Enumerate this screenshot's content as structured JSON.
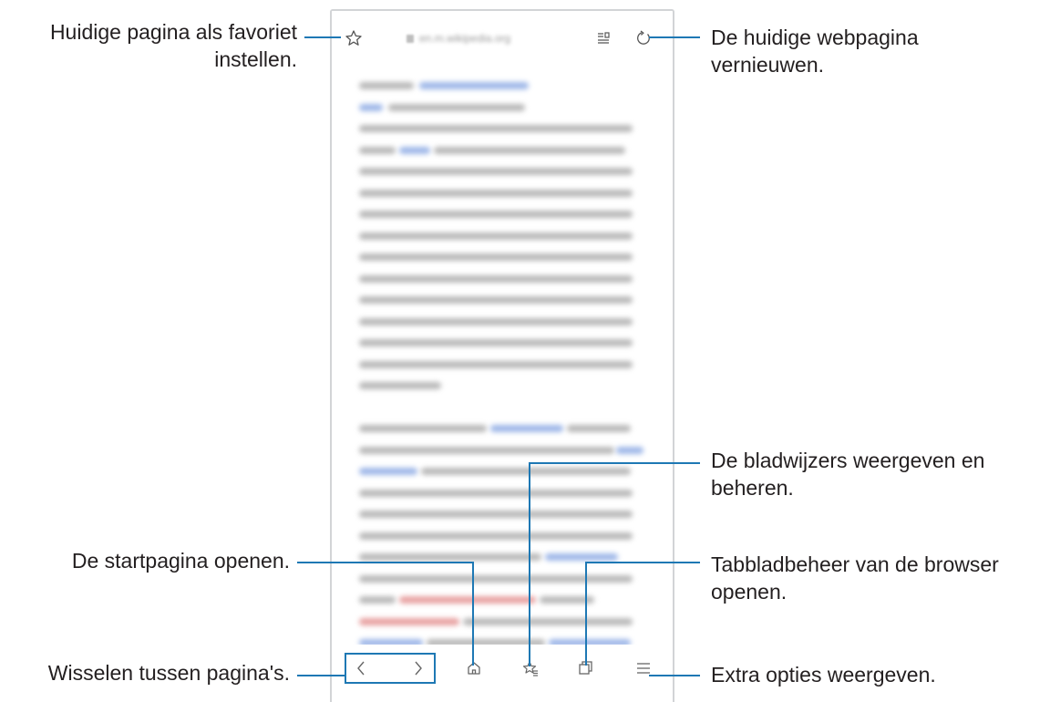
{
  "browser": {
    "url": "en.m.wikipedia.org",
    "icons": {
      "favorite": "star-outline-icon",
      "reader": "reader-mode-icon",
      "refresh": "refresh-icon",
      "back": "chevron-left-icon",
      "forward": "chevron-right-icon",
      "home": "home-icon",
      "bookmarks": "bookmark-star-icon",
      "tabs": "tabs-icon",
      "menu": "hamburger-menu-icon"
    }
  },
  "callouts": {
    "favorite": "Huidige pagina als favoriet instellen.",
    "refresh": "De huidige webpagina vernieuwen.",
    "bookmarks": "De bladwijzers weergeven en beheren.",
    "home": "De startpagina openen.",
    "tabs": "Tabbladbeheer van de browser openen.",
    "navigate": "Wisselen tussen pagina's.",
    "options": "Extra opties weergeven."
  },
  "colors": {
    "leader": "#1e78b4",
    "text": "#231f20",
    "frame": "#d2d4d6"
  }
}
